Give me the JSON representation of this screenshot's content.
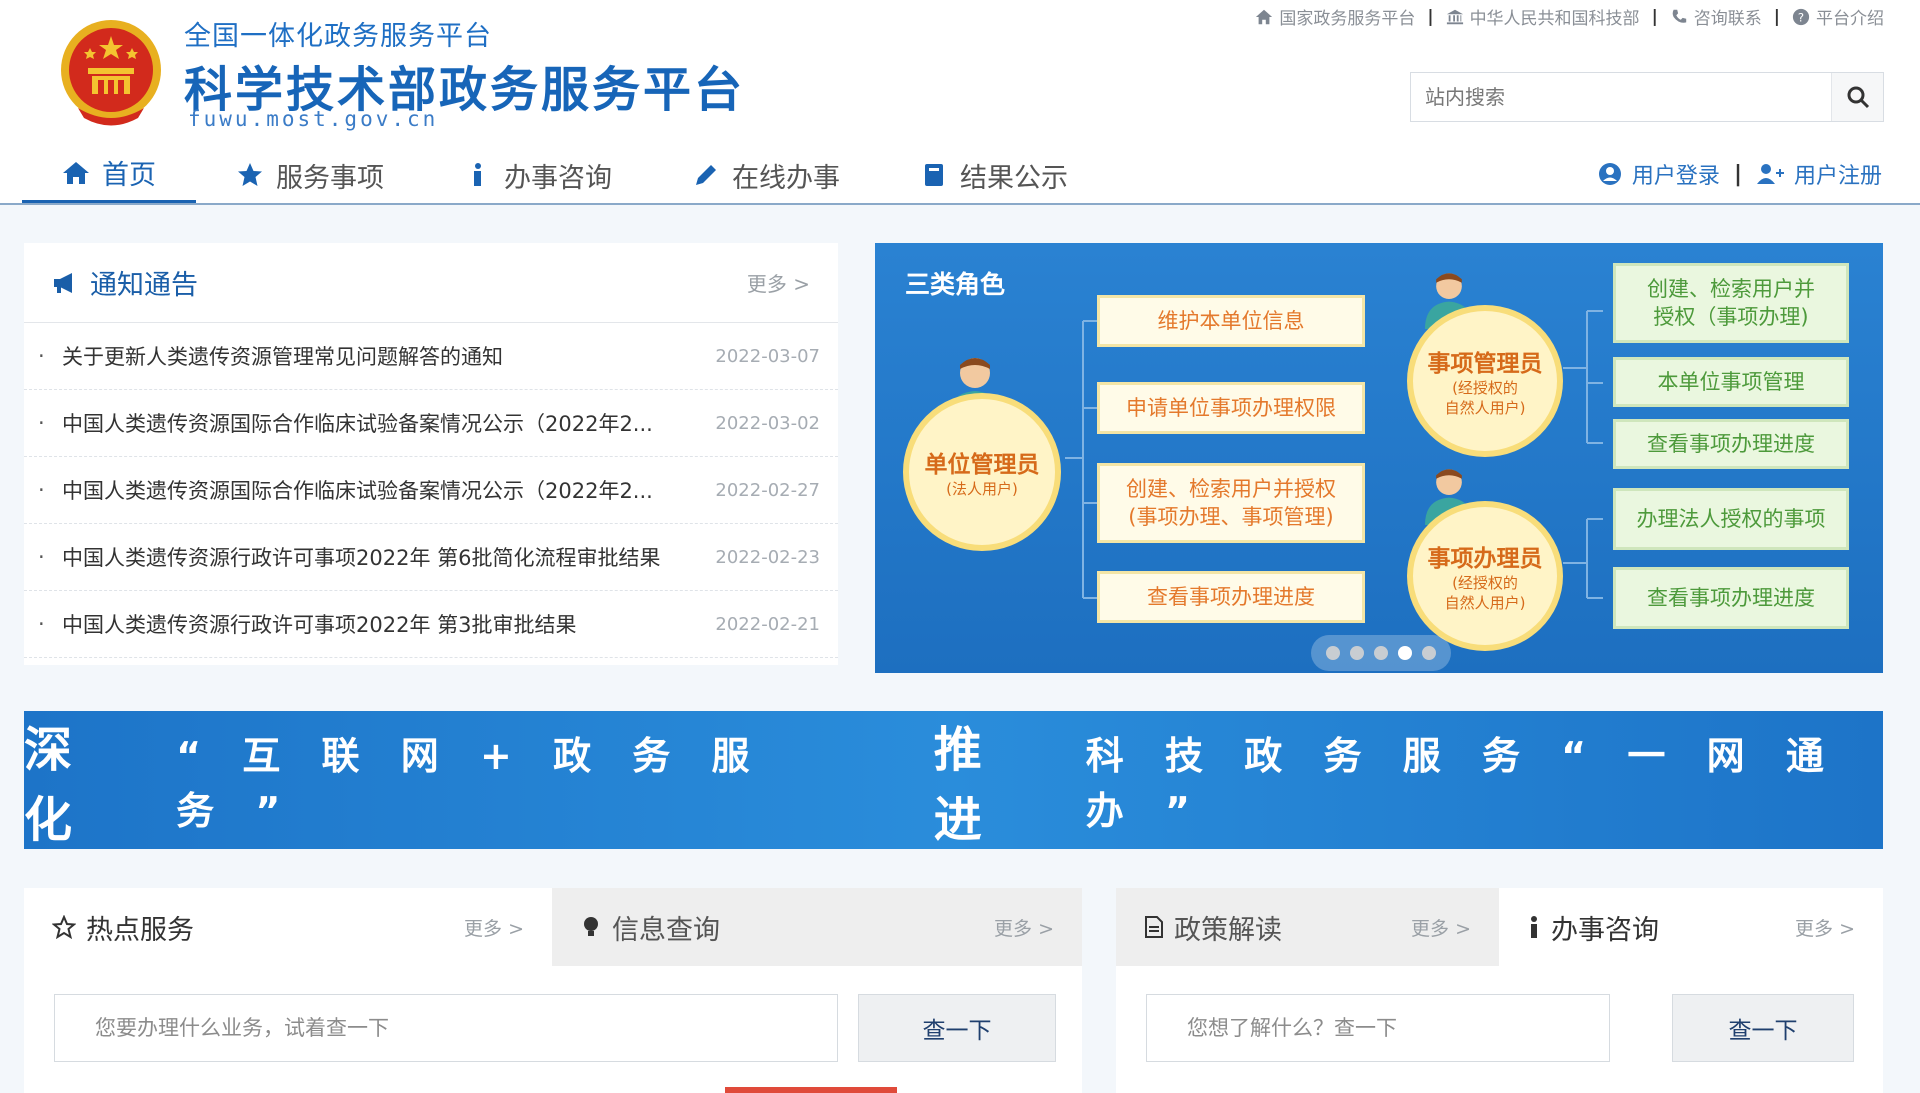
{
  "header": {
    "sub_title": "全国一体化政务服务平台",
    "main_title": "科学技术部政务服务平台",
    "domain": "fuwu.most.gov.cn",
    "top_links": [
      {
        "label": "国家政务服务平台",
        "icon": "home-icon"
      },
      {
        "label": "中华人民共和国科技部",
        "icon": "bank-icon"
      },
      {
        "label": "咨询联系",
        "icon": "phone-icon"
      },
      {
        "label": "平台介绍",
        "icon": "question-circle-icon"
      }
    ],
    "search_placeholder": "站内搜索"
  },
  "nav": {
    "items": [
      {
        "label": "首页",
        "icon": "home-icon",
        "active": true
      },
      {
        "label": "服务事项",
        "icon": "star-icon"
      },
      {
        "label": "办事咨询",
        "icon": "info-icon"
      },
      {
        "label": "在线办事",
        "icon": "pencil-icon"
      },
      {
        "label": "结果公示",
        "icon": "book-icon"
      }
    ],
    "login": "用户登录",
    "register": "用户注册"
  },
  "notice": {
    "title": "通知通告",
    "more": "更多 >",
    "items": [
      {
        "title": "关于更新人类遗传资源管理常见问题解答的通知",
        "date": "2022-03-07"
      },
      {
        "title": "中国人类遗传资源国际合作临床试验备案情况公示（2022年2...",
        "date": "2022-03-02"
      },
      {
        "title": "中国人类遗传资源国际合作临床试验备案情况公示（2022年2...",
        "date": "2022-02-27"
      },
      {
        "title": "中国人类遗传资源行政许可事项2022年 第6批简化流程审批结果",
        "date": "2022-02-23"
      },
      {
        "title": "中国人类遗传资源行政许可事项2022年 第3批审批结果",
        "date": "2022-02-21"
      }
    ]
  },
  "roles": {
    "title": "三类角色",
    "unit_admin": {
      "name": "单位管理员",
      "sub": "(法人用户)"
    },
    "item_manager": {
      "name": "事项管理员",
      "sub1": "(经授权的",
      "sub2": "自然人用户)"
    },
    "item_handler": {
      "name": "事项办理员",
      "sub1": "(经授权的",
      "sub2": "自然人用户)"
    },
    "unit_boxes": [
      {
        "line1": "维护本单位信息"
      },
      {
        "line1": "申请单位事项办理权限"
      },
      {
        "line1": "创建、检索用户并授权",
        "line2": "(事项办理、事项管理)"
      },
      {
        "line1": "查看事项办理进度"
      }
    ],
    "manager_boxes": [
      {
        "line1": "创建、检索用户并",
        "line2": "授权（事项办理)"
      },
      {
        "line1": "本单位事项管理"
      },
      {
        "line1": "查看事项办理进度"
      }
    ],
    "handler_boxes": [
      {
        "line1": "办理法人授权的事项"
      },
      {
        "line1": "查看事项办理进度"
      }
    ],
    "carousel_active": 4,
    "carousel_total": 5
  },
  "slogan": {
    "part1_big": "深 化",
    "part1_small": "“ 互 联 网 + 政 务 服 务 ”",
    "part2_big": "推 进",
    "part2_small": "科 技 政 务 服 务 “ 一 网 通 办 ”"
  },
  "left_bottom": {
    "tab1": {
      "label": "热点服务",
      "more": "更多 >",
      "icon": "star-outline-icon"
    },
    "tab2": {
      "label": "信息查询",
      "more": "更多 >",
      "icon": "bulb-icon"
    },
    "placeholder": "您要办理什么业务，试着查一下",
    "button": "查一下"
  },
  "right_bottom": {
    "tab1": {
      "label": "政策解读",
      "more": "更多 >",
      "icon": "document-icon"
    },
    "tab2": {
      "label": "办事咨询",
      "more": "更多 >",
      "icon": "info-icon"
    },
    "placeholder": "您想了解什么？查一下",
    "button": "查一下"
  },
  "colors": {
    "brand_blue": "#1a63b2",
    "role_orange": "#e4792c",
    "role_green": "#4d9a3b"
  }
}
